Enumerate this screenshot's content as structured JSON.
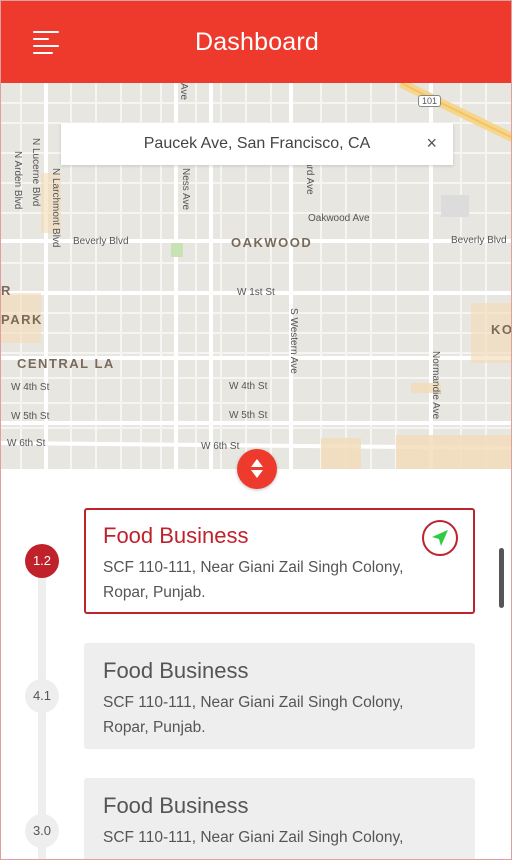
{
  "header": {
    "title": "Dashboard",
    "menu_icon": "menu-icon"
  },
  "search": {
    "value": "Paucek Ave, San Francisco, CA",
    "close_icon": "close-icon",
    "close_glyph": "×"
  },
  "map": {
    "labels": {
      "beverly_blvd_w": "Beverly Blvd",
      "beverly_blvd_e": "Beverly Blvd",
      "oakwood": "OAKWOOD",
      "oakwood_ave": "Oakwood Ave",
      "w_1st_st": "W 1st St",
      "central_la": "CENTRAL LA",
      "w_4th_st_w": "W 4th St",
      "w_4th_st_e": "W 4th St",
      "w_5th_st_w": "W 5th St",
      "w_5th_st_e": "W 5th St",
      "w_6th_st_w": "W 6th St",
      "w_6th_st_e": "W 6th St",
      "park_r": "R",
      "park": "PARK",
      "ko": "KO",
      "n_lucerne_blvd": "N Lucerne Blvd",
      "n_arden_blvd": "N Arden Blvd",
      "n_larchmont_blvd": "N Larchmont Blvd",
      "ness_ave": "Ness Ave",
      "ave_top": "Ave",
      "ard_ave": "ard Ave",
      "s_western_ave": "S Western Ave",
      "normandie_ave": "Normandie Ave",
      "hwy_101": "101"
    },
    "toggle_icon": "sort-arrows-icon"
  },
  "timeline": {
    "items": [
      {
        "badge": "1.2",
        "title": "Food Business",
        "address": "SCF 110-111, Near Giani Zail Singh Colony, Ropar, Punjab.",
        "active": true
      },
      {
        "badge": "4.1",
        "title": "Food Business",
        "address": "SCF 110-111, Near Giani Zail Singh Colony, Ropar, Punjab.",
        "active": false
      },
      {
        "badge": "3.0",
        "title": "Food Business",
        "address": "SCF 110-111, Near Giani Zail Singh Colony,",
        "active": false
      }
    ],
    "navigate_icon": "navigate-arrow-icon"
  },
  "colors": {
    "brand": "#ee3a2d",
    "active": "#c0222c",
    "nav_arrow": "#2ecc40",
    "card_bg": "#eeeeee"
  }
}
